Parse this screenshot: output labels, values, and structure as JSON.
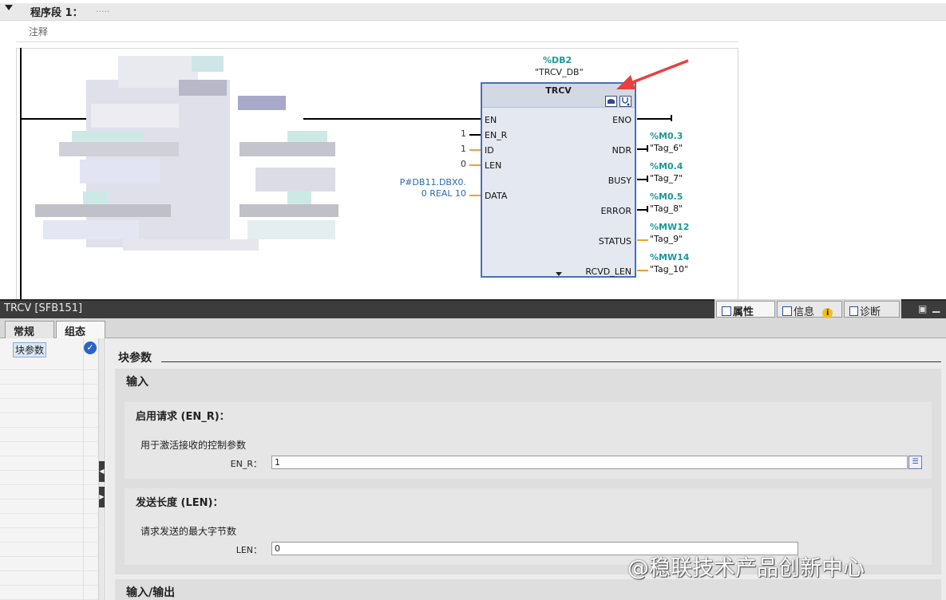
{
  "segment": {
    "title": "程序段 1：",
    "title_dots": ".....",
    "comment": "注释"
  },
  "block": {
    "db_address": "%DB2",
    "db_name": "\"TRCV_DB\"",
    "title": "TRCV",
    "inputs": [
      {
        "pin": "EN",
        "value": ""
      },
      {
        "pin": "EN_R",
        "value": "1"
      },
      {
        "pin": "ID",
        "value": "1"
      },
      {
        "pin": "LEN",
        "value": "0"
      },
      {
        "pin": "DATA",
        "value_line1": "P#DB11.DBX0.",
        "value_line2": "0 REAL 10"
      }
    ],
    "outputs": [
      {
        "pin": "ENO",
        "address": "",
        "tag": ""
      },
      {
        "pin": "NDR",
        "address": "%M0.3",
        "tag": "\"Tag_6\""
      },
      {
        "pin": "BUSY",
        "address": "%M0.4",
        "tag": "\"Tag_7\""
      },
      {
        "pin": "ERROR",
        "address": "%M0.5",
        "tag": "\"Tag_8\""
      },
      {
        "pin": "STATUS",
        "address": "%MW12",
        "tag": "\"Tag_9\""
      },
      {
        "pin": "RCVD_LEN",
        "address": "%MW14",
        "tag": "\"Tag_10\""
      }
    ]
  },
  "inspector": {
    "title": "TRCV [SFB151]",
    "tabs": [
      "属性",
      "信息",
      "诊断"
    ],
    "info_badge": "i",
    "subtabs": [
      "常规",
      "组态"
    ],
    "nav_item": "块参数",
    "section_title": "块参数",
    "group_input": "输入",
    "group_inout": "输入/输出",
    "enr": {
      "title": "启用请求 (EN_R)：",
      "desc": "用于激活接收的控制参数",
      "label": "EN_R：",
      "value": "1"
    },
    "len": {
      "title": "发送长度 (LEN)：",
      "desc": "请求发送的最大字节数",
      "label": "LEN：",
      "value": "0"
    }
  },
  "watermark": "@稳联技术产品创新中心",
  "colors": {
    "accent_teal": "#1a9a9a",
    "block_border": "#4a6fb8",
    "arrow_red": "#e84040",
    "wire_orange": "#f0a030"
  }
}
